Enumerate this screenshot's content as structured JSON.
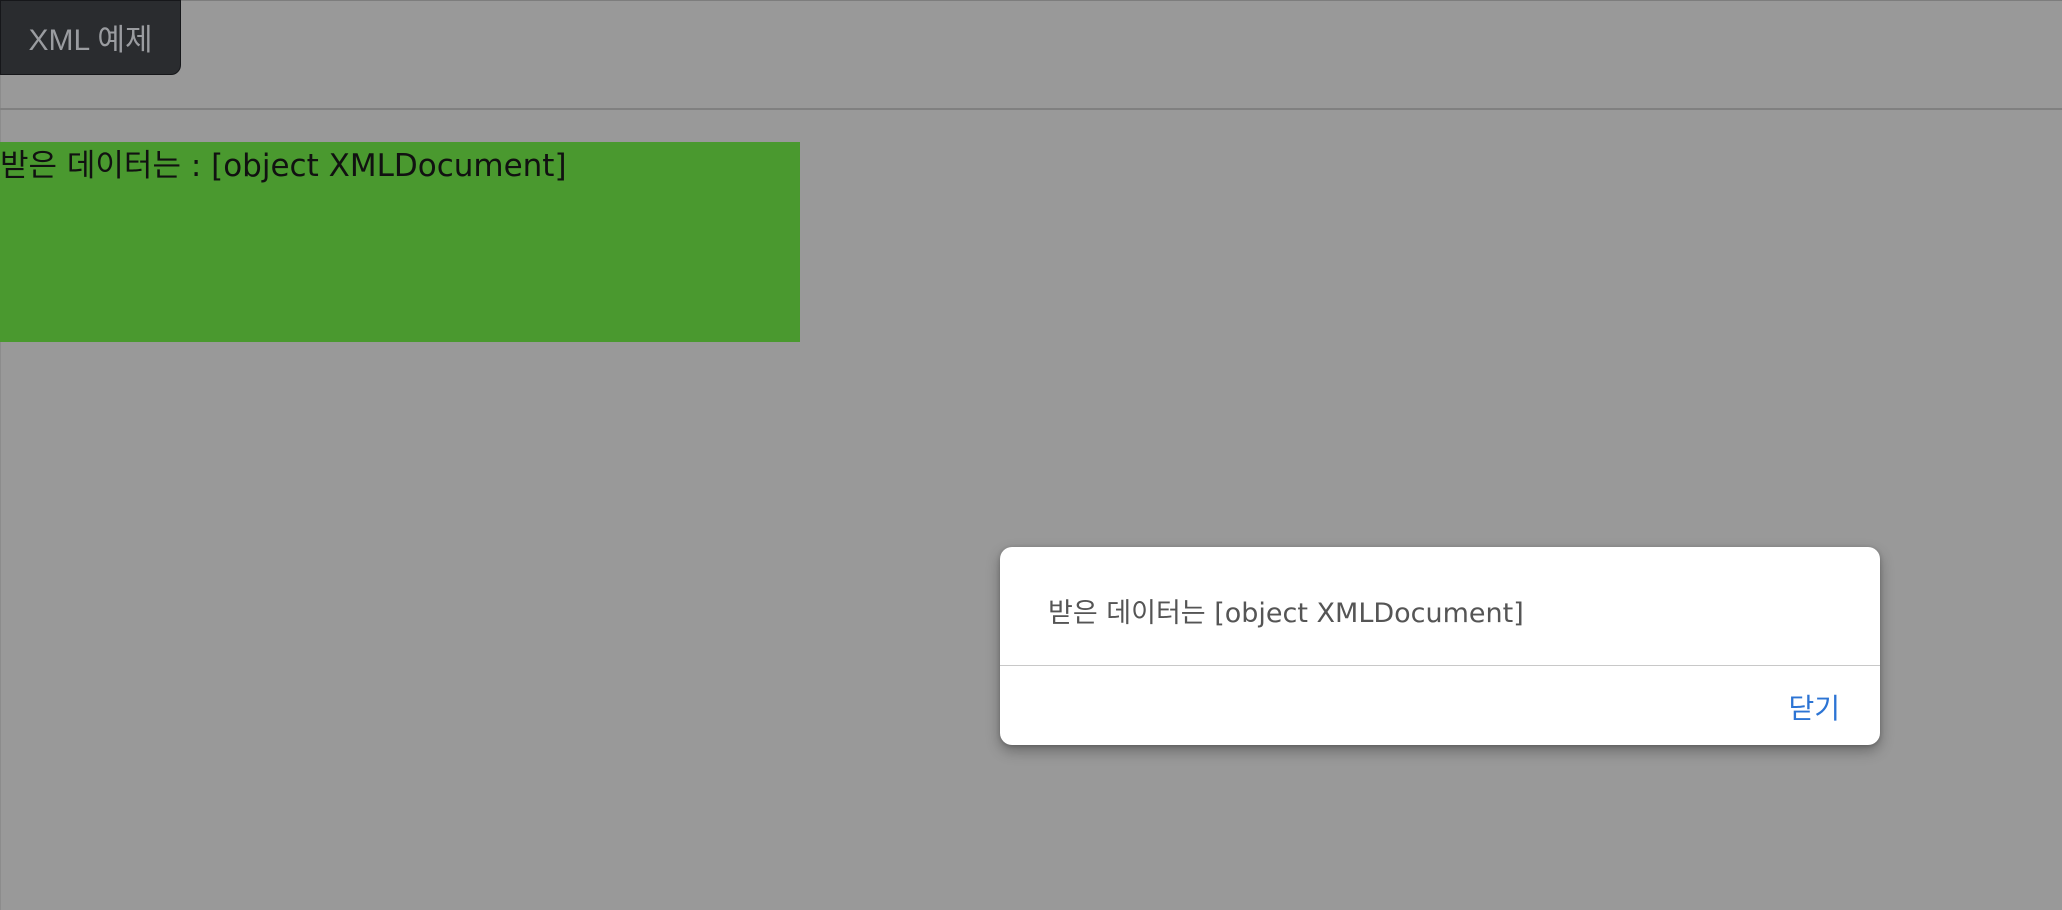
{
  "toolbar": {
    "xml_button_label": "XML 예제"
  },
  "result": {
    "text": "받은 데이터는 : [object XMLDocument]"
  },
  "alert": {
    "message": "받은 데이터는 [object XMLDocument]",
    "close_label": "닫기"
  },
  "colors": {
    "page_background": "#999999",
    "result_background": "#4a992f",
    "button_background": "#2a2c2f",
    "dialog_background": "#ffffff",
    "close_link": "#2c74d4"
  }
}
